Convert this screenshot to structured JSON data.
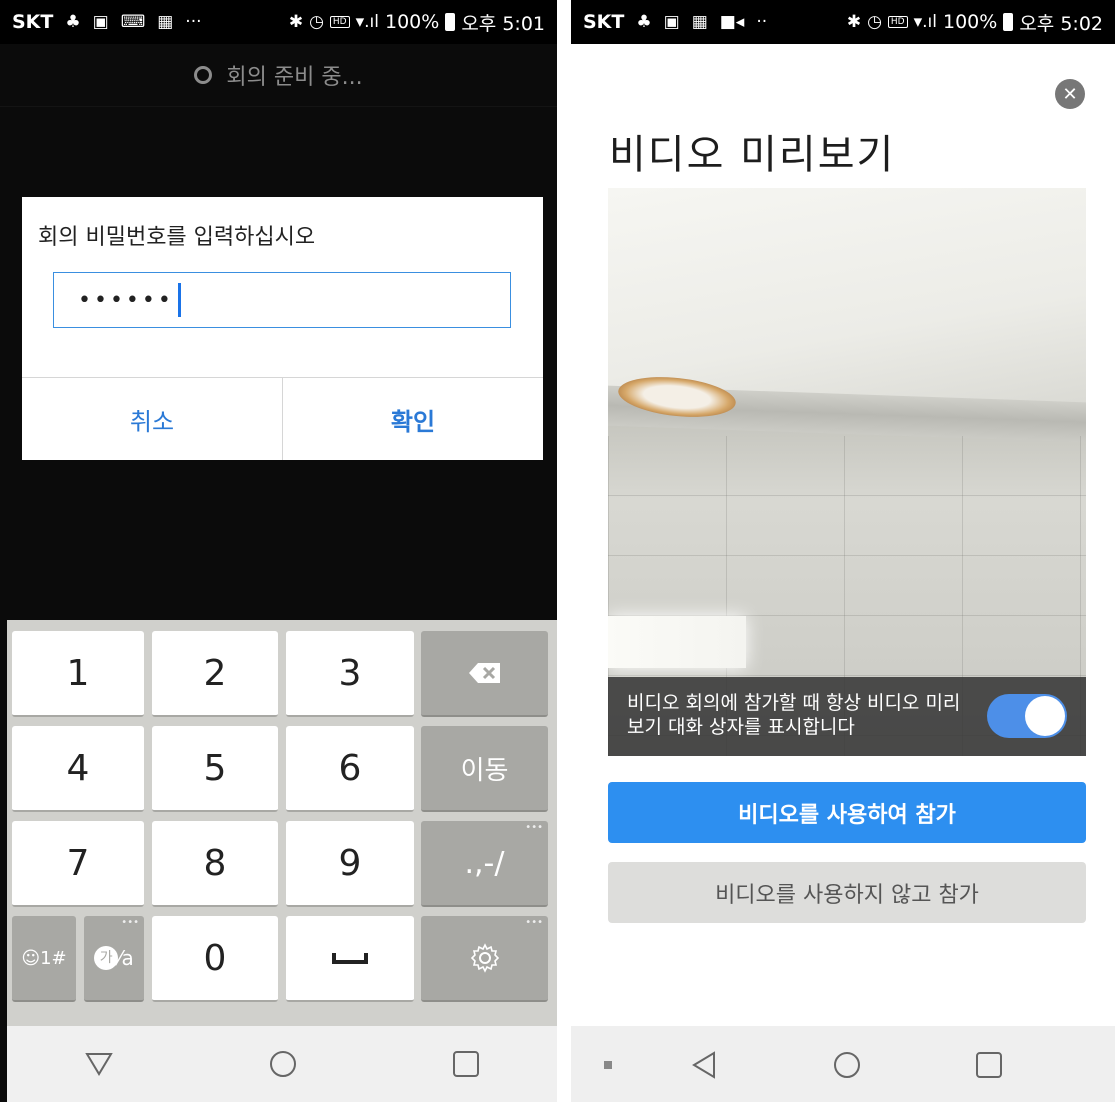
{
  "left": {
    "status": {
      "carrier": "SKT",
      "battery": "100%",
      "time": "오후 5:01",
      "hd": "HD"
    },
    "top_status": "회의 준비 중...",
    "dialog": {
      "title": "회의 비밀번호를 입력하십시오",
      "password_value": "••••••",
      "cancel_label": "취소",
      "ok_label": "확인"
    },
    "keyboard": {
      "k1": "1",
      "k2": "2",
      "k3": "3",
      "k4": "4",
      "k5": "5",
      "k6": "6",
      "k7": "7",
      "k8": "8",
      "k9": "9",
      "k0": "0",
      "move_label": "이동",
      "punct_label": ".,-/",
      "emoji_label": "☺1#",
      "lang_label_ko": "가",
      "lang_label_en": "⁄a"
    }
  },
  "right": {
    "status": {
      "carrier": "SKT",
      "battery": "100%",
      "time": "오후 5:02",
      "hd": "HD"
    },
    "title": "비디오 미리보기",
    "overlay_text": "비디오 회의에 참가할 때 항상 비디오 미리보기 대화 상자를 표시합니다",
    "toggle_on": true,
    "join_with_video_label": "비디오를 사용하여 참가",
    "join_without_video_label": "비디오를 사용하지 않고 참가"
  }
}
